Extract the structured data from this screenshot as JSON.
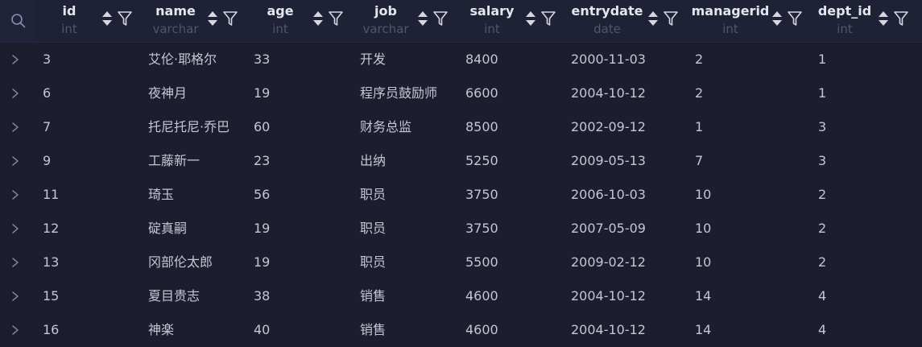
{
  "columns": [
    {
      "name": "id",
      "type": "int"
    },
    {
      "name": "name",
      "type": "varchar"
    },
    {
      "name": "age",
      "type": "int"
    },
    {
      "name": "job",
      "type": "varchar"
    },
    {
      "name": "salary",
      "type": "int"
    },
    {
      "name": "entrydate",
      "type": "date"
    },
    {
      "name": "managerid",
      "type": "int"
    },
    {
      "name": "dept_id",
      "type": "int"
    }
  ],
  "rows": [
    [
      "3",
      "艾伦·耶格尔",
      "33",
      "开发",
      "8400",
      "2000-11-03",
      "2",
      "1"
    ],
    [
      "6",
      "夜神月",
      "19",
      "程序员鼓励师",
      "6600",
      "2004-10-12",
      "2",
      "1"
    ],
    [
      "7",
      "托尼托尼·乔巴",
      "60",
      "财务总监",
      "8500",
      "2002-09-12",
      "1",
      "3"
    ],
    [
      "9",
      "工藤新一",
      "23",
      "出纳",
      "5250",
      "2009-05-13",
      "7",
      "3"
    ],
    [
      "11",
      "琦玉",
      "56",
      "职员",
      "3750",
      "2006-10-03",
      "10",
      "2"
    ],
    [
      "12",
      "碇真嗣",
      "19",
      "职员",
      "3750",
      "2007-05-09",
      "10",
      "2"
    ],
    [
      "13",
      "冈部伦太郎",
      "19",
      "职员",
      "5500",
      "2009-02-12",
      "10",
      "2"
    ],
    [
      "15",
      "夏目贵志",
      "38",
      "销售",
      "4600",
      "2004-10-12",
      "14",
      "4"
    ],
    [
      "16",
      "神楽",
      "40",
      "销售",
      "4600",
      "2004-10-12",
      "14",
      "4"
    ]
  ],
  "icons": {
    "search": "search-icon",
    "sort": "sort-icon",
    "filter": "filter-icon",
    "expand": "chevron-right-icon"
  },
  "colors": {
    "background": "#1c1e30",
    "header_background": "#1f2236",
    "text": "#c4c6d2",
    "header_text": "#e4e6ee",
    "type_text": "#51556d"
  }
}
